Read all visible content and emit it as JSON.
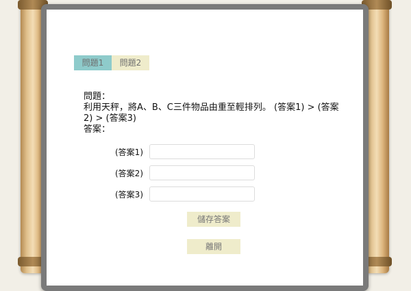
{
  "tabs": [
    {
      "label": "問題1",
      "active": true
    },
    {
      "label": "問題2",
      "active": false
    }
  ],
  "question": {
    "heading": "問題：",
    "text": "利用天秤，將A、B、C三件物品由重至輕排列。 (答案1) > (答案2) > (答案3)",
    "answer_heading": "答案："
  },
  "answers": [
    {
      "label": "(答案1)",
      "value": ""
    },
    {
      "label": "(答案2)",
      "value": ""
    },
    {
      "label": "(答案3)",
      "value": ""
    }
  ],
  "buttons": {
    "save_label": "儲存答案",
    "leave_label": "離開"
  },
  "colors": {
    "tab_active": "#8ecbcb",
    "tab_inactive": "#efeccb",
    "button_bg": "#efeccb",
    "paper_frame": "#7a7a7a"
  }
}
